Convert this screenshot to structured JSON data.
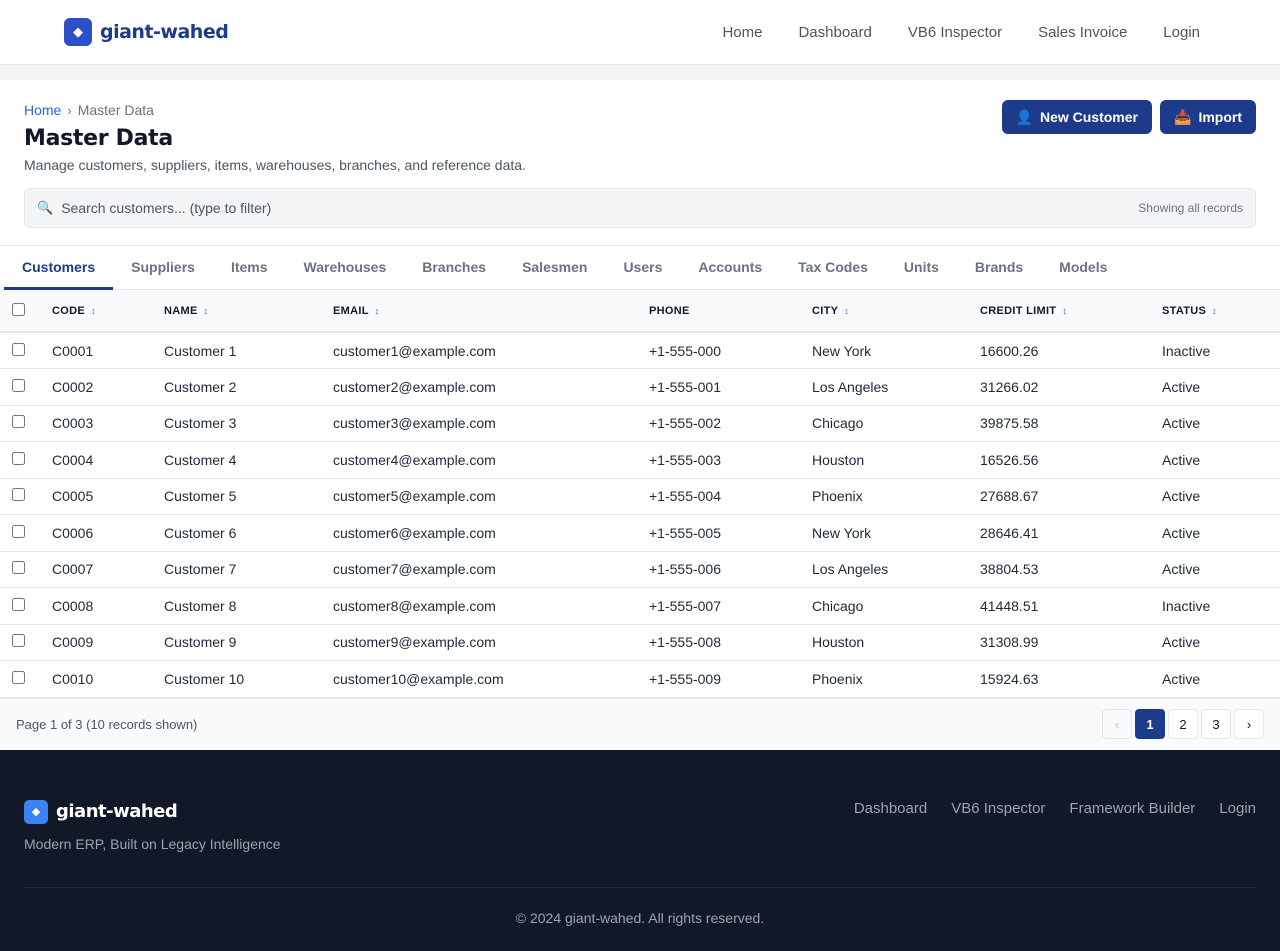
{
  "brand": {
    "name": "giant-wahed"
  },
  "topnav": [
    {
      "label": "Home"
    },
    {
      "label": "Dashboard"
    },
    {
      "label": "VB6 Inspector"
    },
    {
      "label": "Sales Invoice"
    },
    {
      "label": "Login"
    }
  ],
  "breadcrumb": {
    "home": "Home",
    "separator": "›",
    "current": "Master Data"
  },
  "page": {
    "title": "Master Data",
    "subtitle": "Manage customers, suppliers, items, warehouses, branches, and reference data."
  },
  "actions": {
    "new_customer": {
      "icon": "👤",
      "label": "New Customer"
    },
    "import": {
      "icon": "📥",
      "label": "Import"
    }
  },
  "search": {
    "icon": "🔍",
    "placeholder": "Search customers... (type to filter)",
    "value": "",
    "note": "Showing all records"
  },
  "tabs": [
    {
      "label": "Customers",
      "active": true
    },
    {
      "label": "Suppliers"
    },
    {
      "label": "Items"
    },
    {
      "label": "Warehouses"
    },
    {
      "label": "Branches"
    },
    {
      "label": "Salesmen"
    },
    {
      "label": "Users"
    },
    {
      "label": "Accounts"
    },
    {
      "label": "Tax Codes"
    },
    {
      "label": "Units"
    },
    {
      "label": "Brands"
    },
    {
      "label": "Models"
    }
  ],
  "table": {
    "sort_glyph": "↕",
    "columns": [
      {
        "label": "Code",
        "sortable": true
      },
      {
        "label": "Name",
        "sortable": true
      },
      {
        "label": "Email",
        "sortable": true
      },
      {
        "label": "Phone",
        "sortable": false
      },
      {
        "label": "City",
        "sortable": true
      },
      {
        "label": "Credit Limit",
        "sortable": true
      },
      {
        "label": "Status",
        "sortable": true
      }
    ],
    "rows": [
      [
        "C0001",
        "Customer 1",
        "customer1@example.com",
        "+1-555-000",
        "New York",
        "16600.26",
        "Inactive"
      ],
      [
        "C0002",
        "Customer 2",
        "customer2@example.com",
        "+1-555-001",
        "Los Angeles",
        "31266.02",
        "Active"
      ],
      [
        "C0003",
        "Customer 3",
        "customer3@example.com",
        "+1-555-002",
        "Chicago",
        "39875.58",
        "Active"
      ],
      [
        "C0004",
        "Customer 4",
        "customer4@example.com",
        "+1-555-003",
        "Houston",
        "16526.56",
        "Active"
      ],
      [
        "C0005",
        "Customer 5",
        "customer5@example.com",
        "+1-555-004",
        "Phoenix",
        "27688.67",
        "Active"
      ],
      [
        "C0006",
        "Customer 6",
        "customer6@example.com",
        "+1-555-005",
        "New York",
        "28646.41",
        "Active"
      ],
      [
        "C0007",
        "Customer 7",
        "customer7@example.com",
        "+1-555-006",
        "Los Angeles",
        "38804.53",
        "Active"
      ],
      [
        "C0008",
        "Customer 8",
        "customer8@example.com",
        "+1-555-007",
        "Chicago",
        "41448.51",
        "Inactive"
      ],
      [
        "C0009",
        "Customer 9",
        "customer9@example.com",
        "+1-555-008",
        "Houston",
        "31308.99",
        "Active"
      ],
      [
        "C0010",
        "Customer 10",
        "customer10@example.com",
        "+1-555-009",
        "Phoenix",
        "15924.63",
        "Active"
      ]
    ]
  },
  "pagination": {
    "info": "Page 1 of 3 (10 records shown)",
    "prev": "‹",
    "next": "›",
    "pages": [
      "1",
      "2",
      "3"
    ],
    "current": "1"
  },
  "footer": {
    "brand": "giant-wahed",
    "tagline": "Modern ERP, Built on Legacy Intelligence",
    "links": [
      {
        "label": "Dashboard"
      },
      {
        "label": "VB6 Inspector"
      },
      {
        "label": "Framework Builder"
      },
      {
        "label": "Login"
      }
    ],
    "copyright": "© 2024 giant-wahed. All rights reserved."
  },
  "colors": {
    "primary": "#1e3a8a",
    "link": "#2563eb",
    "footer_bg": "#111827"
  }
}
